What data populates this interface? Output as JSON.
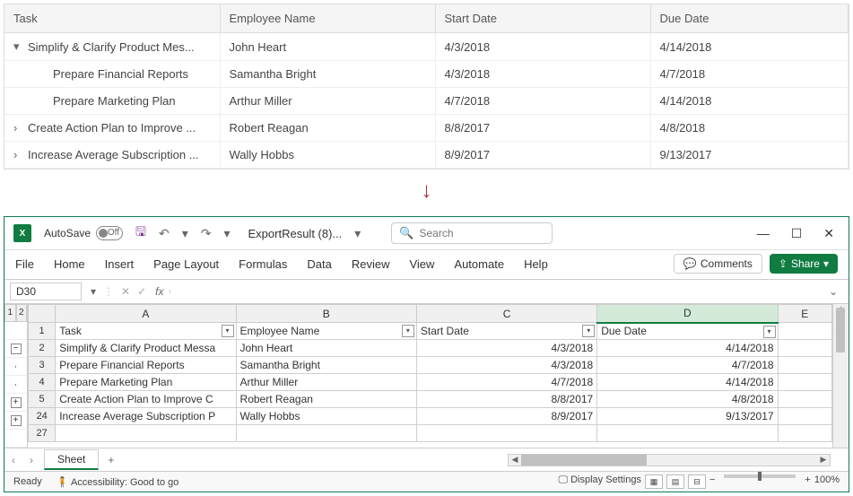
{
  "top_grid": {
    "columns": [
      "Task",
      "Employee Name",
      "Start Date",
      "Due Date"
    ],
    "rows": [
      {
        "icon": "expanded",
        "indent": 0,
        "task": "Simplify & Clarify Product Mes...",
        "employee": "John Heart",
        "start": "4/3/2018",
        "due": "4/14/2018"
      },
      {
        "icon": "",
        "indent": 1,
        "task": "Prepare Financial Reports",
        "employee": "Samantha Bright",
        "start": "4/3/2018",
        "due": "4/7/2018"
      },
      {
        "icon": "",
        "indent": 1,
        "task": "Prepare Marketing Plan",
        "employee": "Arthur Miller",
        "start": "4/7/2018",
        "due": "4/14/2018"
      },
      {
        "icon": "collapsed",
        "indent": 0,
        "task": "Create Action Plan to Improve ...",
        "employee": "Robert Reagan",
        "start": "8/8/2017",
        "due": "4/8/2018"
      },
      {
        "icon": "collapsed",
        "indent": 0,
        "task": "Increase Average Subscription ...",
        "employee": "Wally Hobbs",
        "start": "8/9/2017",
        "due": "9/13/2017"
      }
    ]
  },
  "excel": {
    "autosave_label": "AutoSave",
    "autosave_state": "Off",
    "doc_title": "ExportResult (8)...",
    "search_placeholder": "Search",
    "ribbon_tabs": [
      "File",
      "Home",
      "Insert",
      "Page Layout",
      "Formulas",
      "Data",
      "Review",
      "View",
      "Automate",
      "Help"
    ],
    "comments_label": "Comments",
    "share_label": "Share",
    "name_box": "D30",
    "outline_levels": [
      "1",
      "2"
    ],
    "col_headers": [
      "A",
      "B",
      "C",
      "D",
      "E"
    ],
    "selected_col": "D",
    "header_row_num": "1",
    "headers": {
      "A": "Task",
      "B": "Employee Name",
      "C": "Start Date",
      "D": "Due Date"
    },
    "data_rows": [
      {
        "num": "2",
        "outline": "minus",
        "A": "Simplify & Clarify Product Messa",
        "B": "John Heart",
        "C": "4/3/2018",
        "D": "4/14/2018"
      },
      {
        "num": "3",
        "outline": "dot",
        "A": "Prepare Financial Reports",
        "B": "Samantha Bright",
        "C": "4/3/2018",
        "D": "4/7/2018"
      },
      {
        "num": "4",
        "outline": "dot",
        "A": "Prepare Marketing Plan",
        "B": "Arthur Miller",
        "C": "4/7/2018",
        "D": "4/14/2018"
      },
      {
        "num": "5",
        "outline": "plus",
        "A": "Create Action Plan to Improve C",
        "B": "Robert Reagan",
        "C": "8/8/2017",
        "D": "4/8/2018"
      },
      {
        "num": "24",
        "outline": "plus",
        "A": "Increase Average Subscription P",
        "B": "Wally Hobbs",
        "C": "8/9/2017",
        "D": "9/13/2017"
      },
      {
        "num": "27",
        "outline": "",
        "A": "",
        "B": "",
        "C": "",
        "D": ""
      }
    ],
    "sheet_tab": "Sheet",
    "status_ready": "Ready",
    "accessibility": "Accessibility: Good to go",
    "display_settings": "Display Settings",
    "zoom": "100%"
  }
}
